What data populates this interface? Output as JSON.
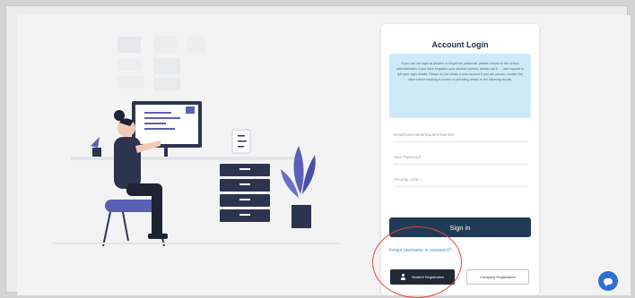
{
  "login": {
    "title": "Account Login",
    "notice": "If you can not login as student or forgot the password, please contact to the school administration. If you have forgotten your student number, please call 0. ... and request to get your login details. Please do not create a new account if you are unsure; contact the office before booking a course or providing details in the following results.",
    "fields": {
      "user": "Email/Username/Student Number",
      "password": "Your Password",
      "captcha": "Security code..."
    },
    "signin_label": "Sign in",
    "forgot_label": "Forgot username or password?",
    "student_registration": "Student Registration",
    "company_registration": "Company Registration"
  },
  "colors": {
    "primary": "#213a56",
    "notice_bg": "#cdeaf8",
    "highlight": "#e0473f",
    "chat": "#2f6fd1",
    "plant": "#5a5fb8"
  },
  "icons": [
    "user-icon",
    "chat-icon"
  ]
}
